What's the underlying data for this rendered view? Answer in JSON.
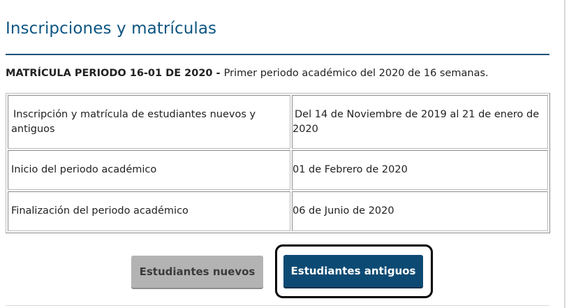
{
  "header": {
    "title": "Inscripciones y matrículas"
  },
  "intro": {
    "period_label": "MATRÍCULA PERIODO 16-01 DE 2020",
    "separator": " - ",
    "description": "Primer periodo académico del 2020 de 16 semanas."
  },
  "schedule": {
    "rows": [
      {
        "label": "Inscripción y matrícula de estudiantes nuevos y antiguos",
        "value": "Del 14 de Noviembre de 2019 al 21 de enero de 2020"
      },
      {
        "label": "Inicio del periodo académico",
        "value": "01 de Febrero de 2020"
      },
      {
        "label": "Finalización del periodo académico",
        "value": "06 de Junio de 2020"
      }
    ]
  },
  "buttons": {
    "new_students_label": "Estudiantes nuevos",
    "returning_students_label": "Estudiantes antiguos"
  },
  "colors": {
    "title": "#0d5582",
    "primary_button": "#0d4a73",
    "secondary_button": "#b3b3b3"
  }
}
